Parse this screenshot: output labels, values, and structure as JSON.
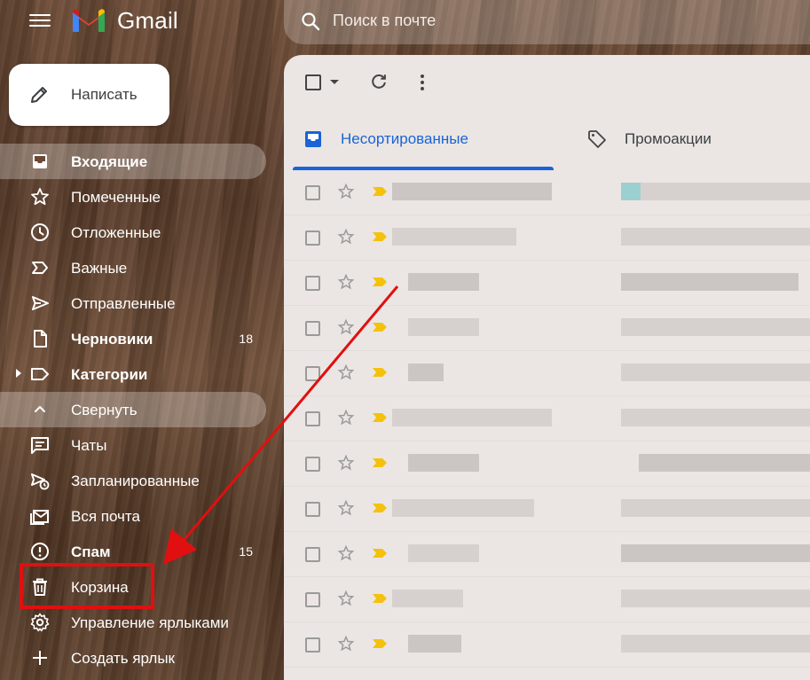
{
  "header": {
    "app_name": "Gmail",
    "search_placeholder": "Поиск в почте"
  },
  "compose": {
    "label": "Написать"
  },
  "sidebar": {
    "items": [
      {
        "label": "Входящие",
        "bold": true,
        "icon": "inbox-icon"
      },
      {
        "label": "Помеченные",
        "icon": "star-icon"
      },
      {
        "label": "Отложенные",
        "icon": "clock-icon"
      },
      {
        "label": "Важные",
        "icon": "important-icon"
      },
      {
        "label": "Отправленные",
        "icon": "send-icon"
      },
      {
        "label": "Черновики",
        "bold": true,
        "count": "18",
        "icon": "draft-icon"
      },
      {
        "label": "Категории",
        "bold": true,
        "icon": "label-icon"
      },
      {
        "label": "Свернуть",
        "icon": "chevron-up-icon"
      },
      {
        "label": "Чаты",
        "icon": "chat-icon"
      },
      {
        "label": "Запланированные",
        "icon": "scheduled-send-icon"
      },
      {
        "label": "Вся почта",
        "icon": "all-mail-icon"
      },
      {
        "label": "Спам",
        "bold": true,
        "count": "15",
        "icon": "spam-icon"
      },
      {
        "label": "Корзина",
        "icon": "trash-icon"
      },
      {
        "label": "Управление ярлыками",
        "icon": "gear-icon"
      },
      {
        "label": "Создать ярлык",
        "icon": "plus-icon"
      }
    ]
  },
  "tabs": [
    {
      "label": "Несортированные",
      "icon": "inbox-tab-icon",
      "active": true
    },
    {
      "label": "Промоакции",
      "icon": "tag-icon"
    }
  ],
  "colors": {
    "accent_blue": "#1a63d8",
    "highlight_red": "#e01010",
    "important_yellow": "#f4c20d"
  }
}
